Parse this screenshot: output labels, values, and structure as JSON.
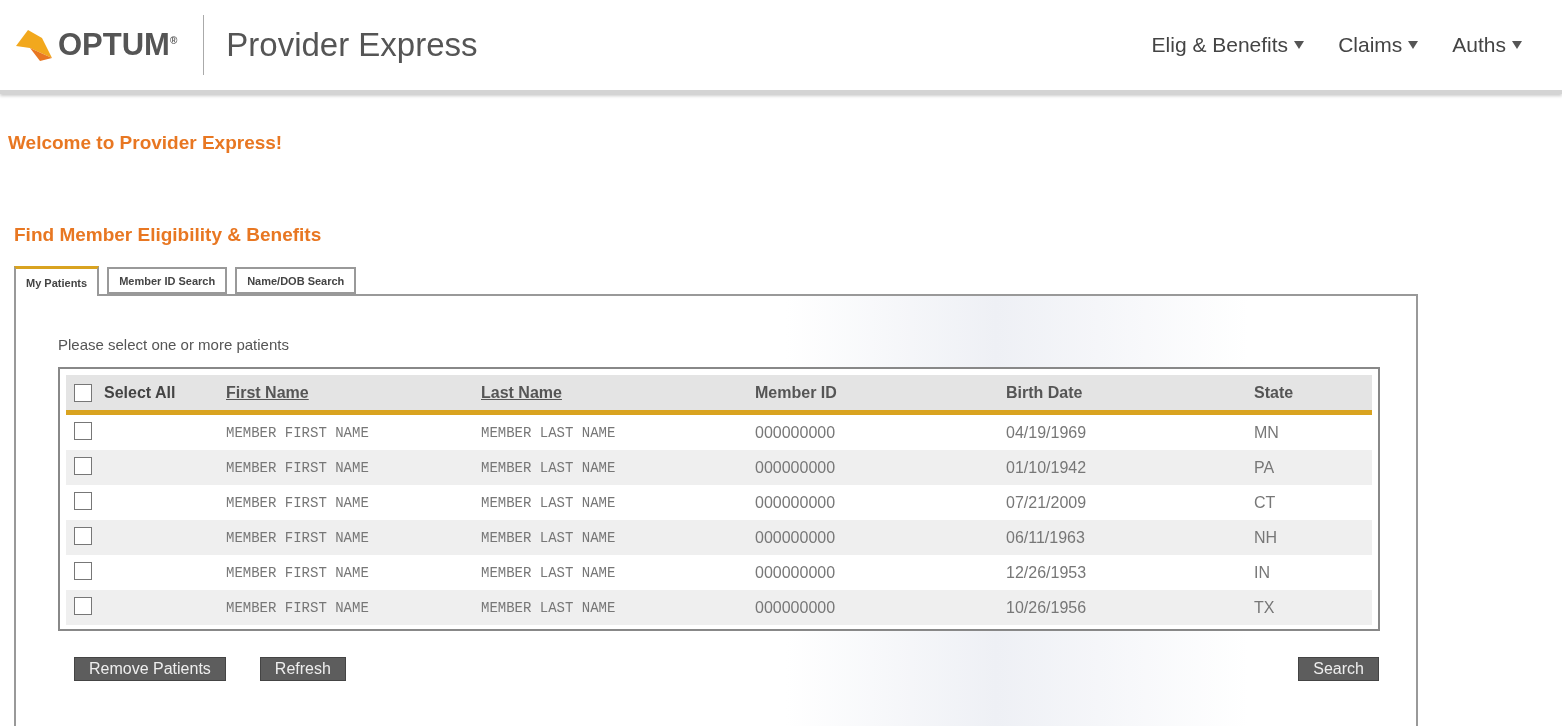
{
  "header": {
    "logo": "OPTUM$^{®}$",
    "title": "Provider Express",
    "nav": [
      {
        "label": "Elig & Benefits"
      },
      {
        "label": "Claims"
      },
      {
        "label": "Auths"
      }
    ]
  },
  "welcome": "Welcome to Provider Express!",
  "heading": "Find Member Eligibility & Benefits",
  "tabs": [
    {
      "label": "My Patients",
      "selected": true
    },
    {
      "label": "Member ID Search",
      "selected": false
    },
    {
      "label": "Name/DOB Search",
      "selected": false
    }
  ],
  "instruction": "Please select one or more patients",
  "table": {
    "select_all": {
      "label": "Select All",
      "checked": false
    },
    "columns": [
      {
        "label": "First Name",
        "link": true
      },
      {
        "label": "Last Name",
        "link": true
      },
      {
        "label": "Member ID",
        "link": false
      },
      {
        "label": "Birth Date",
        "link": false
      },
      {
        "label": "State",
        "link": false
      }
    ],
    "rows": [
      {
        "checked": false,
        "cells": [
          "MEMBER FIRST NAME",
          "MEMBER LAST NAME",
          "000000000",
          "04/19/1969",
          "MN"
        ]
      },
      {
        "checked": false,
        "cells": [
          "MEMBER FIRST NAME",
          "MEMBER LAST NAME",
          "000000000",
          "01/10/1942",
          "PA"
        ]
      },
      {
        "checked": false,
        "cells": [
          "MEMBER FIRST NAME",
          "MEMBER LAST NAME",
          "000000000",
          "07/21/2009",
          "CT"
        ]
      },
      {
        "checked": false,
        "cells": [
          "MEMBER FIRST NAME",
          "MEMBER LAST NAME",
          "000000000",
          "06/11/1963",
          "NH"
        ]
      },
      {
        "checked": false,
        "cells": [
          "MEMBER FIRST NAME",
          "MEMBER LAST NAME",
          "000000000",
          "12/26/1953",
          "IN"
        ]
      },
      {
        "checked": false,
        "cells": [
          "MEMBER FIRST NAME",
          "MEMBER LAST NAME",
          "000000000",
          "10/26/1956",
          "TX"
        ]
      }
    ]
  },
  "buttons": {
    "left": [
      "Remove Patients",
      "Refresh"
    ],
    "right": [
      "Search"
    ]
  }
}
